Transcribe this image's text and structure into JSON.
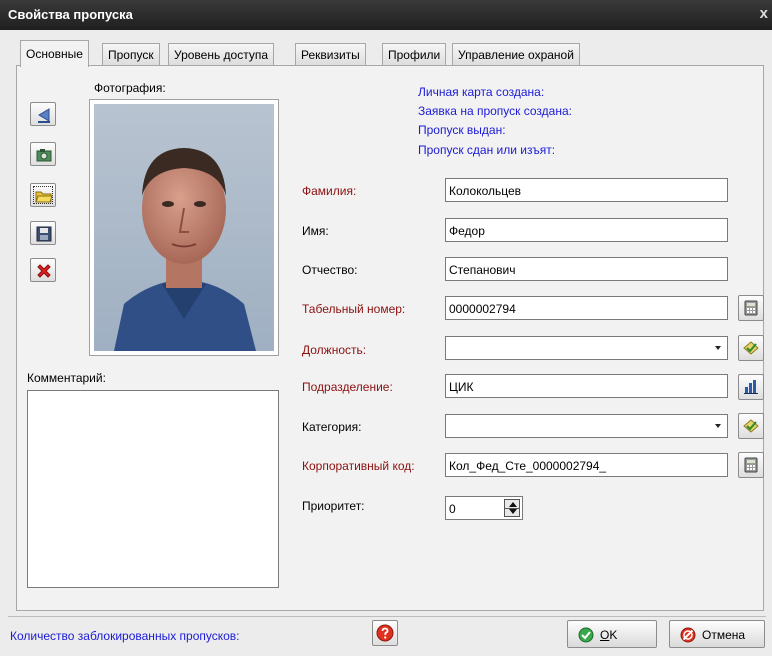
{
  "window": {
    "title": "Свойства пропуска",
    "close_glyph": "x"
  },
  "tabs": [
    {
      "label": "Основные",
      "active": true
    },
    {
      "label": "Пропуск",
      "active": false
    },
    {
      "label": "Уровень доступа",
      "active": false
    },
    {
      "label": "Реквизиты",
      "active": false
    },
    {
      "label": "Профили",
      "active": false
    },
    {
      "label": "Управление охраной",
      "active": false
    }
  ],
  "photo": {
    "label": "Фотография:"
  },
  "photo_tools": {
    "icons": [
      "arrow-left-icon",
      "camera-icon",
      "open-folder-icon",
      "save-disk-icon",
      "delete-x-icon"
    ]
  },
  "comment": {
    "label": "Комментарий:",
    "value": ""
  },
  "status_lines": [
    "Личная карта создана:",
    "Заявка на пропуск создана:",
    "Пропуск выдан:",
    "Пропуск сдан или изъят:"
  ],
  "form": {
    "last_name": {
      "label": "Фамилия:",
      "value": "Колокольцев",
      "required": true
    },
    "first_name": {
      "label": "Имя:",
      "value": "Федор",
      "required": false
    },
    "patronymic": {
      "label": "Отчество:",
      "value": "Степанович",
      "required": false
    },
    "employee_id": {
      "label": "Табельный номер:",
      "value": "0000002794",
      "required": true,
      "button_icon": "calculator-icon"
    },
    "position": {
      "label": "Должность:",
      "value": "",
      "required": true,
      "button_icon": "pick-list-icon"
    },
    "department": {
      "label": "Подразделение:",
      "value": "ЦИК",
      "required": true,
      "button_icon": "org-tree-icon"
    },
    "category": {
      "label": "Категория:",
      "value": "",
      "required": false,
      "button_icon": "pick-list-icon"
    },
    "corporate_code": {
      "label": "Корпоративный код:",
      "value": "Кол_Фед_Сте_0000002794_",
      "required": true,
      "button_icon": "calculator-icon"
    },
    "priority": {
      "label": "Приоритет:",
      "value": "0",
      "required": false
    }
  },
  "footer": {
    "blocked_label": "Количество заблокированных пропусков:",
    "ok_label": "OK",
    "ok_accel": "O",
    "cancel_label": "Отмена"
  },
  "colors": {
    "title_bar": "#1f1f1f",
    "required_label": "#8b1010",
    "info_text": "#1b1bd6",
    "panel_bg": "#f2f2f2"
  }
}
